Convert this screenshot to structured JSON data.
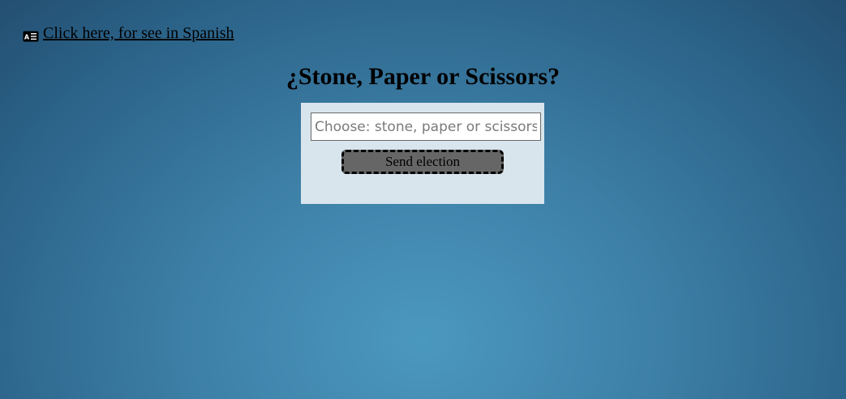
{
  "language_link": {
    "icon": "language-icon",
    "text": "Click here, for see in Spanish"
  },
  "title": "¿Stone, Paper or Scissors?",
  "choice_input": {
    "placeholder": "Choose: stone, paper or scissors",
    "value": ""
  },
  "send_button_label": "Send election",
  "colors": {
    "background_center": "#4b98bf",
    "background_edge": "#234f72",
    "panel": "#d8e5ed",
    "button": "#666666"
  }
}
